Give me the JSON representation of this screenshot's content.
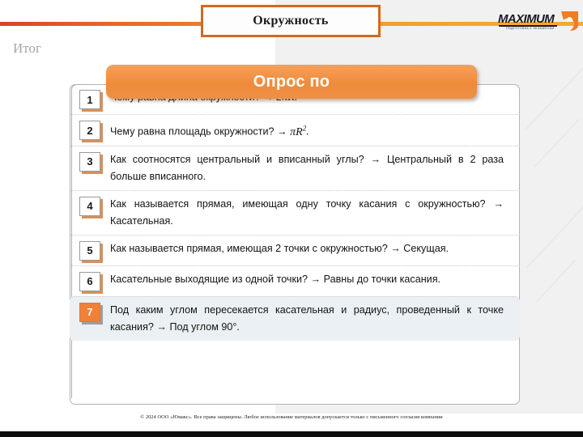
{
  "header": {
    "title": "Окружность",
    "section_label": "Итог",
    "logo": {
      "word": "MAXIMUM",
      "subtitle": "ПОДГОТОВКА К ЭКЗАМЕНАМ",
      "mark_color": "#f07c23"
    },
    "rule_color": "#ee8c3c"
  },
  "banner": {
    "label": "Опрос по"
  },
  "rows": [
    {
      "number": "1",
      "text_before": "Чему равна длина окружности? → ",
      "formula": "2πR",
      "formula_sup": "",
      "text_after": ".",
      "highlight": false
    },
    {
      "number": "2",
      "text_before": "Чему равна площадь окружности? → ",
      "formula": "πR",
      "formula_sup": "2",
      "text_after": ".",
      "highlight": false
    },
    {
      "number": "3",
      "text_before": "Как соотносятся центральный и вписанный углы? → Центральный в 2 раза больше вписанного.",
      "formula": "",
      "formula_sup": "",
      "text_after": "",
      "highlight": false
    },
    {
      "number": "4",
      "text_before": "Как называется прямая, имеющая одну точку касания с окружностью? → Касательная.",
      "formula": "",
      "formula_sup": "",
      "text_after": "",
      "highlight": false
    },
    {
      "number": "5",
      "text_before": "Как называется прямая, имеющая 2 точки с окружностью? → Секущая.",
      "formula": "",
      "formula_sup": "",
      "text_after": "",
      "highlight": false
    },
    {
      "number": "6",
      "text_before": "Касательные выходящие из одной точки? → Равны до точки касания.",
      "formula": "",
      "formula_sup": "",
      "text_after": "",
      "highlight": false
    },
    {
      "number": "7",
      "text_before": "Под каким углом пересекается касательная и радиус, проведенный к точке касания? → Под углом 90°.",
      "formula": "",
      "formula_sup": "",
      "text_after": "",
      "highlight": true
    }
  ],
  "footer": {
    "copyright": "© 2024 ООО «Юмакс». Все права защищены. Любое использование материалов допускается только с  письменного согласия компании"
  },
  "colors": {
    "accent_orange": "#ee8c3c",
    "title_border": "#d2691e",
    "highlight_row": "#eaf0f3",
    "panel_border": "#b3b3b3"
  }
}
